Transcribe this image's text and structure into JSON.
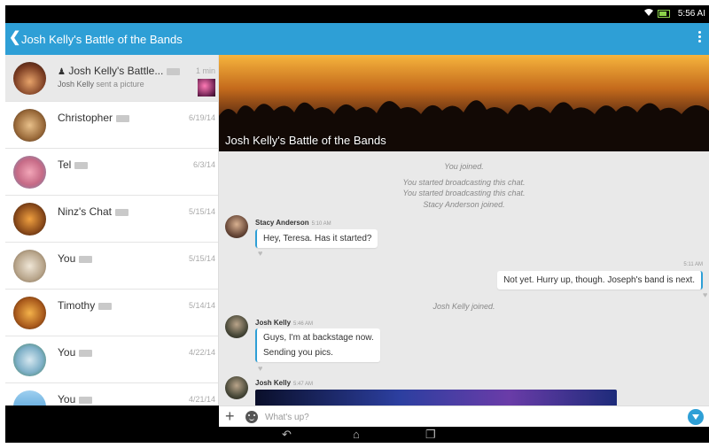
{
  "status_bar": {
    "time": "5:56 AI"
  },
  "app_bar": {
    "title": "Josh Kelly's Battle of the Bands"
  },
  "chat_list": [
    {
      "name": "Josh Kelly's Battle...",
      "subtitle_sender": "Josh Kelly",
      "subtitle_text": "sent a picture",
      "date": "1 min"
    },
    {
      "name": "Christopher",
      "date": "6/19/14"
    },
    {
      "name": "Tel",
      "date": "6/3/14"
    },
    {
      "name": "Ninz's Chat",
      "date": "5/15/14"
    },
    {
      "name": "You",
      "date": "5/15/14"
    },
    {
      "name": "Timothy",
      "date": "5/14/14"
    },
    {
      "name": "You",
      "date": "4/22/14"
    },
    {
      "name": "You",
      "date": "4/21/14"
    }
  ],
  "conversation": {
    "banner_title": "Josh Kelly's Battle of the Bands",
    "system_1": "You joined.",
    "system_2": "You started broadcasting this chat.",
    "system_3": "You started broadcasting this chat.",
    "system_4": "Stacy Anderson joined.",
    "msg1": {
      "sender": "Stacy Anderson",
      "time": "5:10 AM",
      "text": "Hey, Teresa. Has it started?"
    },
    "msg2": {
      "time": "5:11 AM",
      "text": "Not yet. Hurry up, though. Joseph's band is next."
    },
    "system_5": "Josh Kelly joined.",
    "msg3": {
      "sender": "Josh Kelly",
      "time": "5:46 AM",
      "line1": "Guys, I'm at backstage now.",
      "line2": "Sending you pics."
    },
    "msg4": {
      "sender": "Josh Kelly",
      "time": "5:47 AM"
    }
  },
  "composer": {
    "placeholder": "What's up?"
  },
  "colors": {
    "accent": "#2e9fd6",
    "chat_bg": "#e9e9e9"
  }
}
